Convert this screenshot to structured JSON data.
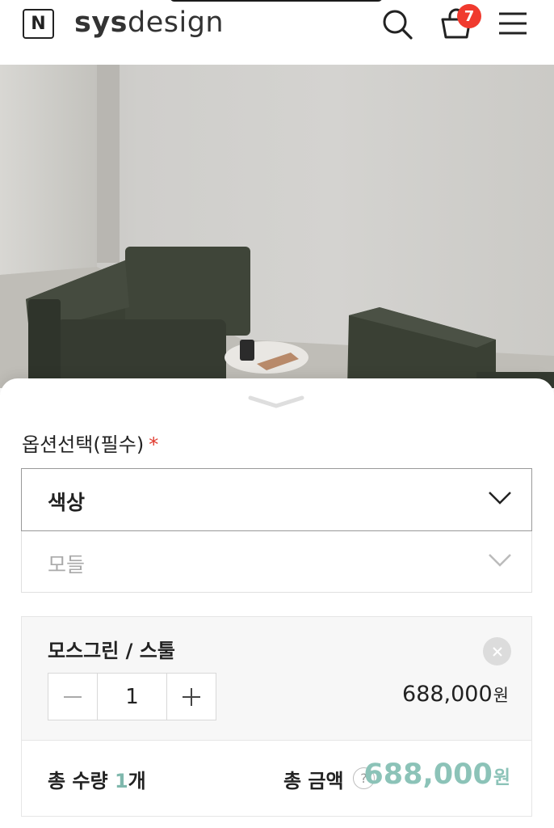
{
  "header": {
    "logo_letter": "N",
    "brand_prefix": "sys",
    "brand_suffix": "design",
    "cart_count": "7"
  },
  "options": {
    "title": "옵션선택(필수)",
    "required_mark": "*",
    "color_select_label": "색상",
    "module_select_label": "모들"
  },
  "selected_item": {
    "name": "모스그린 / 스툴",
    "quantity": "1",
    "price": "688,000",
    "currency": "원"
  },
  "summary": {
    "quantity_label": "총 수량",
    "quantity_value": "1",
    "quantity_unit": "개",
    "amount_label": "총 금액",
    "help": "?",
    "amount_value": "688,000",
    "currency": "원"
  },
  "colors": {
    "badge": "#f03a2e",
    "accent": "#8cc3b8",
    "required": "#e03a2e"
  }
}
